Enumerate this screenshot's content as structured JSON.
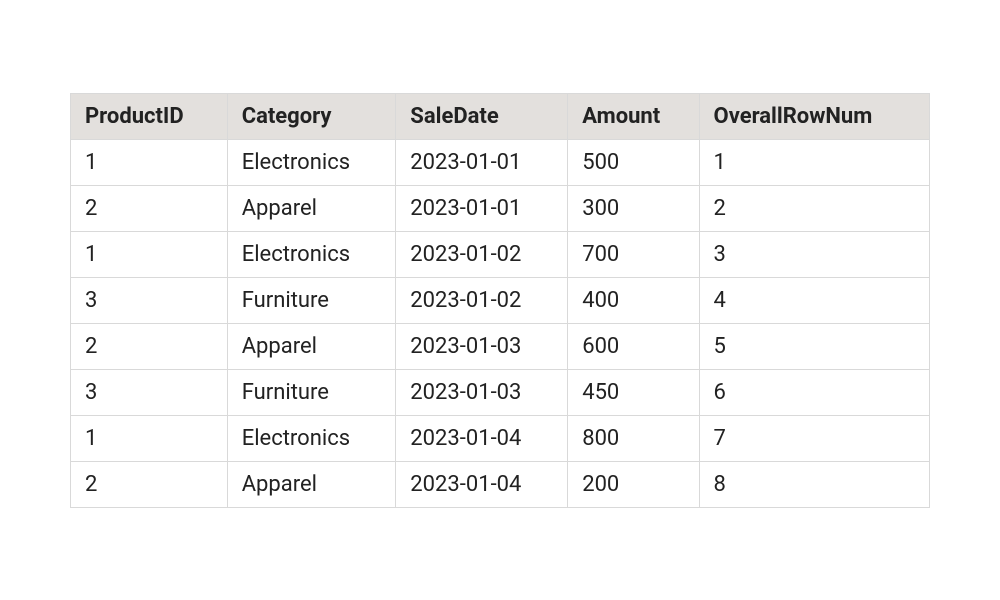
{
  "chart_data": {
    "type": "table",
    "columns": [
      "ProductID",
      "Category",
      "SaleDate",
      "Amount",
      "OverallRowNum"
    ],
    "rows": [
      [
        "1",
        "Electronics",
        "2023-01-01",
        "500",
        "1"
      ],
      [
        "2",
        "Apparel",
        "2023-01-01",
        "300",
        "2"
      ],
      [
        "1",
        "Electronics",
        "2023-01-02",
        "700",
        "3"
      ],
      [
        "3",
        "Furniture",
        "2023-01-02",
        "400",
        "4"
      ],
      [
        "2",
        "Apparel",
        "2023-01-03",
        "600",
        "5"
      ],
      [
        "3",
        "Furniture",
        "2023-01-03",
        "450",
        "6"
      ],
      [
        "1",
        "Electronics",
        "2023-01-04",
        "800",
        "7"
      ],
      [
        "2",
        "Apparel",
        "2023-01-04",
        "200",
        "8"
      ]
    ]
  }
}
